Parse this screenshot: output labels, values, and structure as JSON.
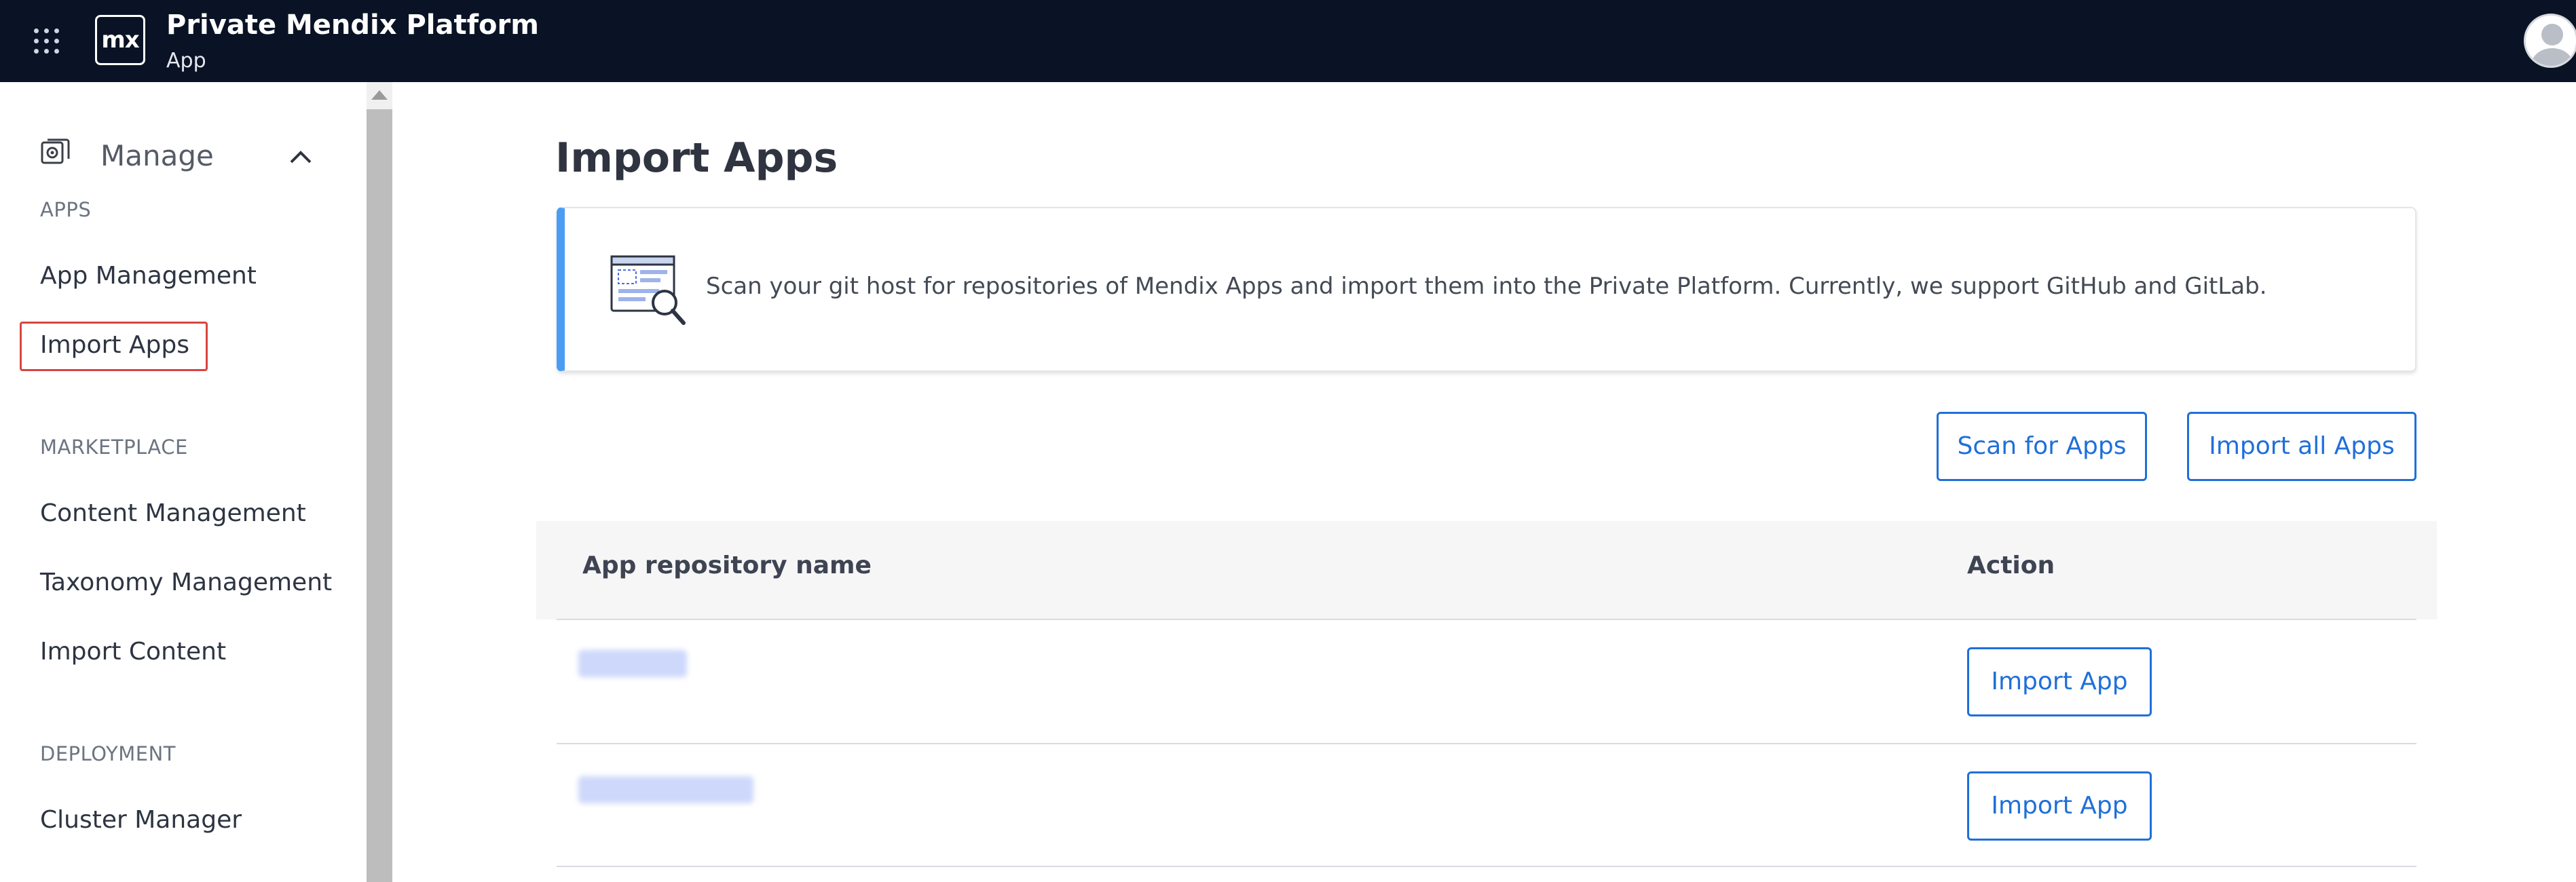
{
  "header": {
    "title": "Private Mendix Platform",
    "subtitle": "App",
    "logo_text": "mx"
  },
  "sidebar": {
    "manage_label": "Manage",
    "sections": [
      {
        "label": "APPS",
        "items": [
          "App Management",
          "Import Apps"
        ]
      },
      {
        "label": "MARKETPLACE",
        "items": [
          "Content Management",
          "Taxonomy Management",
          "Import Content"
        ]
      },
      {
        "label": "DEPLOYMENT",
        "items": [
          "Cluster Manager"
        ]
      }
    ],
    "active_item": "Import Apps"
  },
  "main": {
    "title": "Import Apps",
    "info_text": "Scan your git host for repositories of Mendix Apps and import them into the Private Platform. Currently, we support GitHub and GitLab.",
    "actions": {
      "scan": "Scan for Apps",
      "import_all": "Import all Apps"
    },
    "table": {
      "columns": [
        "App repository name",
        "Action"
      ],
      "rows": [
        {
          "name_blurred": true,
          "action": "Import App"
        },
        {
          "name_blurred": true,
          "action": "Import App"
        }
      ]
    }
  },
  "colors": {
    "topbar_bg": "#0a1325",
    "accent": "#1f6fd9",
    "card_accent": "#4a9df2",
    "active_outline": "#d9443f"
  }
}
